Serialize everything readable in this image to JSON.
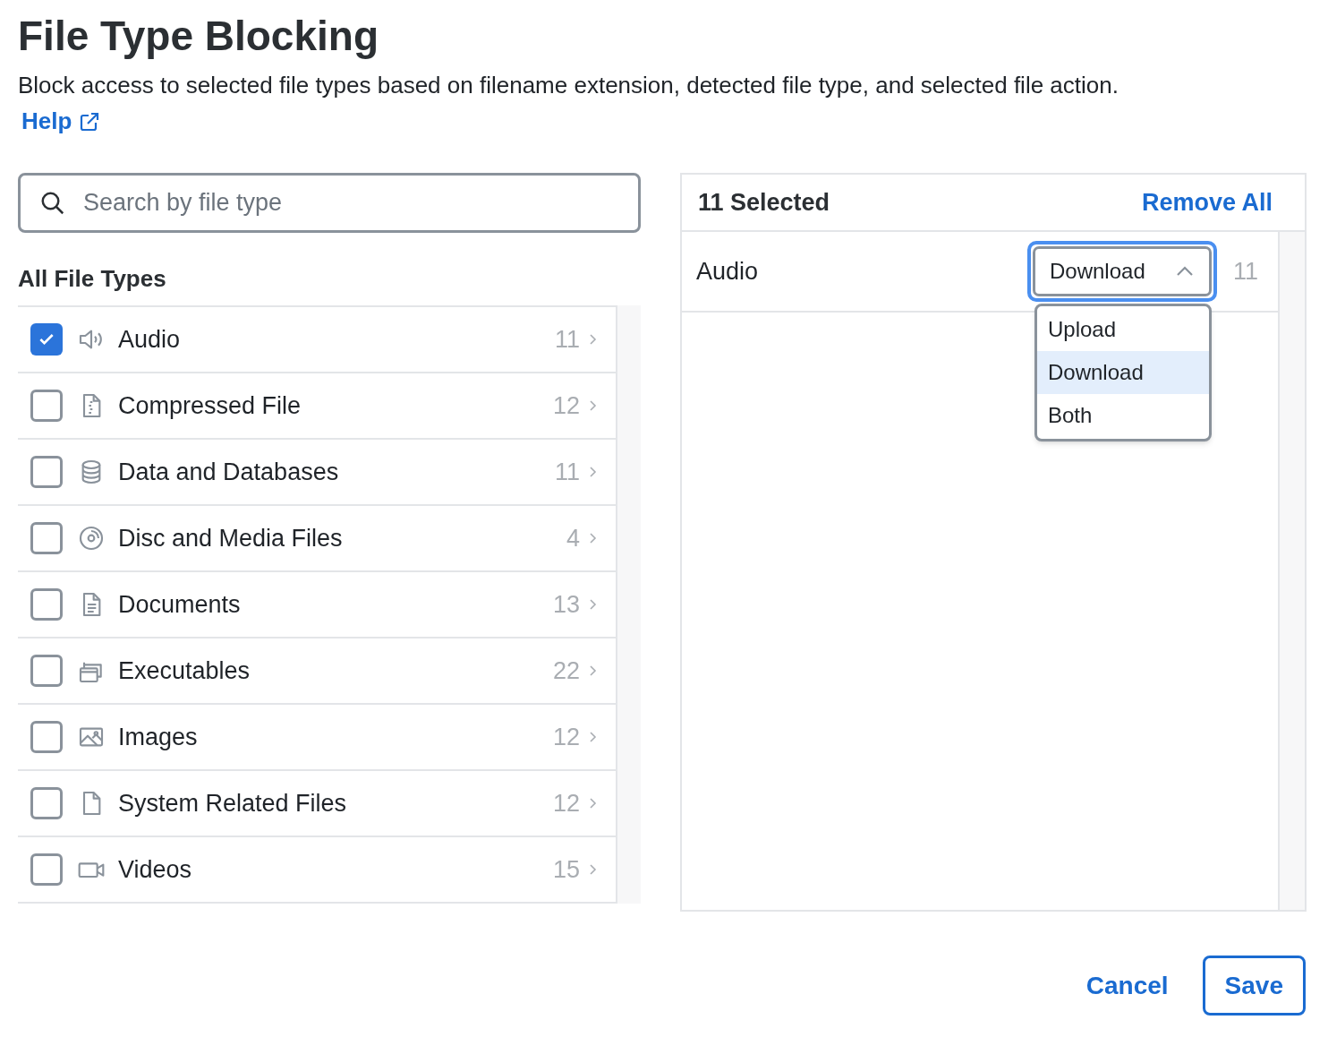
{
  "title": "File Type Blocking",
  "description": "Block access to selected file types based on filename extension, detected file type, and selected file action.",
  "help_link": "Help",
  "search": {
    "placeholder": "Search by file type"
  },
  "list_heading": "All File Types",
  "file_types": [
    {
      "label": "Audio",
      "count": "11",
      "checked": true
    },
    {
      "label": "Compressed File",
      "count": "12",
      "checked": false
    },
    {
      "label": "Data and Databases",
      "count": "11",
      "checked": false
    },
    {
      "label": "Disc and Media Files",
      "count": "4",
      "checked": false
    },
    {
      "label": "Documents",
      "count": "13",
      "checked": false
    },
    {
      "label": "Executables",
      "count": "22",
      "checked": false
    },
    {
      "label": "Images",
      "count": "12",
      "checked": false
    },
    {
      "label": "System Related Files",
      "count": "12",
      "checked": false
    },
    {
      "label": "Videos",
      "count": "15",
      "checked": false
    }
  ],
  "selected_panel": {
    "heading": "11 Selected",
    "remove_all": "Remove All",
    "rows": [
      {
        "label": "Audio",
        "action": "Download",
        "count": "11",
        "expanded": true,
        "options": [
          {
            "label": "Upload",
            "selected": false
          },
          {
            "label": "Download",
            "selected": true
          },
          {
            "label": "Both",
            "selected": false
          }
        ]
      }
    ]
  },
  "buttons": {
    "cancel": "Cancel",
    "save": "Save"
  }
}
